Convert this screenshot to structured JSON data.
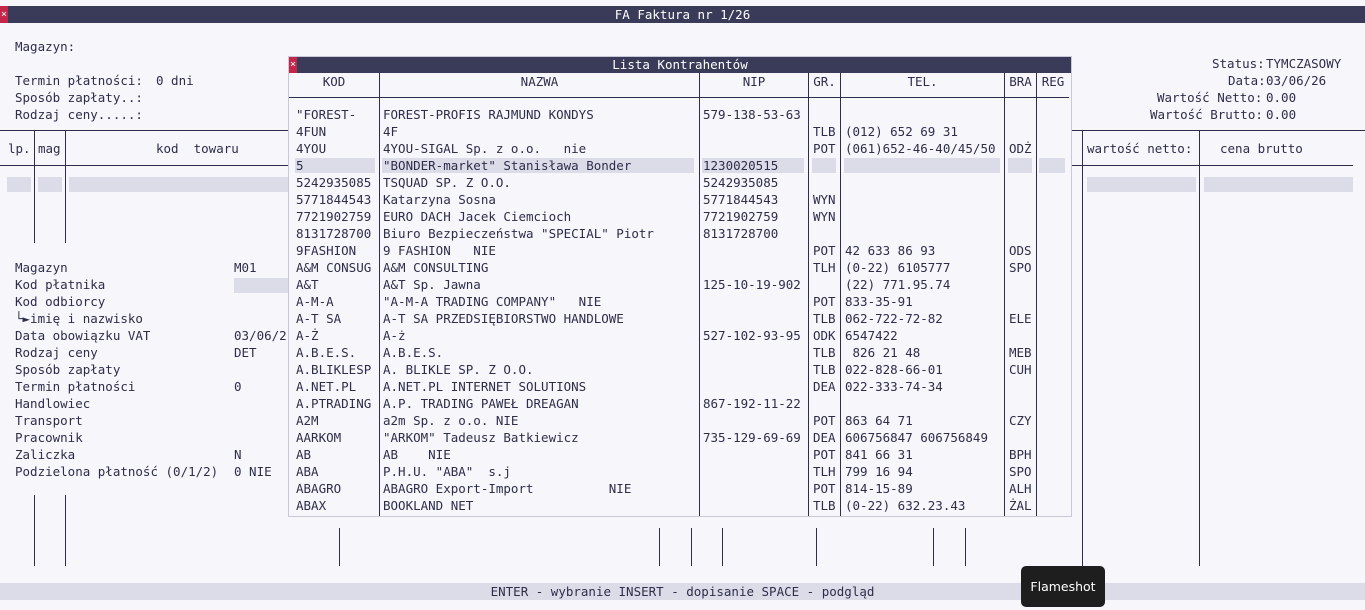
{
  "window": {
    "title": "FA Faktura nr 1/26",
    "close": "×"
  },
  "header": {
    "magazyn_label": "Magazyn:",
    "termin_label": "Termin płatności:",
    "termin_value": "0 dni",
    "sposob_label": "Sposób zapłaty..:",
    "rodzaj_label": "Rodzaj ceny.....:",
    "status_label": "Status:",
    "status_value": "TYMCZASOWY",
    "data_label": "Data:",
    "data_value": "03/06/26",
    "netto_label": "Wartość Netto:",
    "netto_value": "0.00",
    "brutto_label": "Wartość Brutto:",
    "brutto_value": "0.00"
  },
  "grid": {
    "col_lp": "lp.",
    "col_mag": "mag",
    "col_kod": "kod  towaru",
    "col_netto": "wartość netto:",
    "col_brutto": "cena brutto"
  },
  "form": [
    {
      "label": "Magazyn",
      "value": "M01"
    },
    {
      "label": "Kod płatnika",
      "value": ""
    },
    {
      "label": "Kod odbiorcy",
      "value": ""
    },
    {
      "label": "└►imię i nazwisko",
      "value": ""
    },
    {
      "label": "Data obowiązku VAT",
      "value": "03/06/2"
    },
    {
      "label": "Rodzaj ceny",
      "value": "DET"
    },
    {
      "label": "Sposób zapłaty",
      "value": ""
    },
    {
      "label": "Termin płatności",
      "value": "0"
    },
    {
      "label": "Handlowiec",
      "value": ""
    },
    {
      "label": "Transport",
      "value": ""
    },
    {
      "label": "Pracownik",
      "value": ""
    },
    {
      "label": "Zaliczka",
      "value": "N"
    },
    {
      "label": "Podzielona płatność (0/1/2)",
      "value": "0 NIE"
    }
  ],
  "modal": {
    "title": "Lista Kontrahentów",
    "close": "×",
    "columns": {
      "kod": "KOD",
      "nazwa": "NAZWA",
      "nip": "NIP",
      "gr": "GR.",
      "tel": "TEL.",
      "bra": "BRA",
      "reg": "REG"
    },
    "rows": [
      {
        "kod": "\"FOREST-",
        "nazwa": "FOREST-PROFIS RAJMUND KONDYS",
        "nip": "579-138-53-63",
        "gr": "",
        "tel": "",
        "bra": "",
        "reg": ""
      },
      {
        "kod": "4FUN",
        "nazwa": "4F",
        "nip": "",
        "gr": "TLB",
        "tel": "(012) 652 69 31",
        "bra": "",
        "reg": ""
      },
      {
        "kod": "4YOU",
        "nazwa": "4YOU-SIGAL Sp. z o.o.   nie",
        "nip": "",
        "gr": "POT",
        "tel": "(061)652-46-40/45/50",
        "bra": "ODŻ",
        "reg": ""
      },
      {
        "kod": "5",
        "nazwa": "\"BONDER-market\" Stanisława Bonder",
        "nip": "1230020515",
        "gr": "",
        "tel": "",
        "bra": "",
        "reg": "",
        "selected": true
      },
      {
        "kod": "5242935085",
        "nazwa": "TSQUAD SP. Z O.O.",
        "nip": "5242935085",
        "gr": "",
        "tel": "",
        "bra": "",
        "reg": ""
      },
      {
        "kod": "5771844543",
        "nazwa": "Katarzyna Sosna",
        "nip": "5771844543",
        "gr": "WYN",
        "tel": "",
        "bra": "",
        "reg": ""
      },
      {
        "kod": "7721902759",
        "nazwa": "EURO DACH Jacek Ciemcioch",
        "nip": "7721902759",
        "gr": "WYN",
        "tel": "",
        "bra": "",
        "reg": ""
      },
      {
        "kod": "8131728700",
        "nazwa": "Biuro Bezpieczeństwa \"SPECIAL\" Piotr",
        "nip": "8131728700",
        "gr": "",
        "tel": "",
        "bra": "",
        "reg": ""
      },
      {
        "kod": "9FASHION",
        "nazwa": "9 FASHION   NIE",
        "nip": "",
        "gr": "POT",
        "tel": "42 633 86 93",
        "bra": "ODS",
        "reg": ""
      },
      {
        "kod": "A&M CONSUG",
        "nazwa": "A&M CONSULTING",
        "nip": "",
        "gr": "TLH",
        "tel": "(0-22) 6105777",
        "bra": "SPO",
        "reg": ""
      },
      {
        "kod": "A&T",
        "nazwa": "A&T Sp. Jawna",
        "nip": "125-10-19-902",
        "gr": "",
        "tel": "(22) 771.95.74",
        "bra": "",
        "reg": ""
      },
      {
        "kod": "A-M-A",
        "nazwa": "\"A-M-A TRADING COMPANY\"   NIE",
        "nip": "",
        "gr": "POT",
        "tel": "833-35-91",
        "bra": "",
        "reg": ""
      },
      {
        "kod": "A-T SA",
        "nazwa": "A-T SA PRZEDSIĘBIORSTWO HANDLOWE",
        "nip": "",
        "gr": "TLB",
        "tel": "062-722-72-82",
        "bra": "ELE",
        "reg": ""
      },
      {
        "kod": "A-Ż",
        "nazwa": "A-ż",
        "nip": "527-102-93-95",
        "gr": "ODK",
        "tel": "6547422",
        "bra": "",
        "reg": ""
      },
      {
        "kod": "A.B.E.S.",
        "nazwa": "A.B.E.S.",
        "nip": "",
        "gr": "TLB",
        "tel": " 826 21 48",
        "bra": "MEB",
        "reg": ""
      },
      {
        "kod": "A.BLIKLESP",
        "nazwa": "A. BLIKLE SP. Z O.O.",
        "nip": "",
        "gr": "TLB",
        "tel": "022-828-66-01",
        "bra": "CUH",
        "reg": ""
      },
      {
        "kod": "A.NET.PL",
        "nazwa": "A.NET.PL INTERNET SOLUTIONS",
        "nip": "",
        "gr": "DEA",
        "tel": "022-333-74-34",
        "bra": "",
        "reg": ""
      },
      {
        "kod": "A.PTRADING",
        "nazwa": "A.P. TRADING PAWEŁ DREAGAN",
        "nip": "867-192-11-22",
        "gr": "",
        "tel": "",
        "bra": "",
        "reg": ""
      },
      {
        "kod": "A2M",
        "nazwa": "a2m Sp. z o.o. NIE",
        "nip": "",
        "gr": "POT",
        "tel": "863 64 71",
        "bra": "CZY",
        "reg": ""
      },
      {
        "kod": "AARKOM",
        "nazwa": "\"ARKOM\" Tadeusz Batkiewicz",
        "nip": "735-129-69-69",
        "gr": "DEA",
        "tel": "606756847 606756849",
        "bra": "",
        "reg": ""
      },
      {
        "kod": "AB",
        "nazwa": "AB    NIE",
        "nip": "",
        "gr": "POT",
        "tel": "841 66 31",
        "bra": "BPH",
        "reg": ""
      },
      {
        "kod": "ABA",
        "nazwa": "P.H.U. \"ABA\"  s.j",
        "nip": "",
        "gr": "TLH",
        "tel": "799 16 94",
        "bra": "SPO",
        "reg": ""
      },
      {
        "kod": "ABAGRO",
        "nazwa": "ABAGRO Export-Import          NIE",
        "nip": "",
        "gr": "POT",
        "tel": "814-15-89",
        "bra": "ALH",
        "reg": ""
      },
      {
        "kod": "ABAX",
        "nazwa": "BOOKLAND NET",
        "nip": "",
        "gr": "TLB",
        "tel": "(0-22) 632.23.43",
        "bra": "ŻAL",
        "reg": ""
      }
    ]
  },
  "footer": {
    "hints": "ENTER - wybranie   INSERT - dopisanie   SPACE - podgląd"
  },
  "tooltip": {
    "text": "Flameshot"
  }
}
